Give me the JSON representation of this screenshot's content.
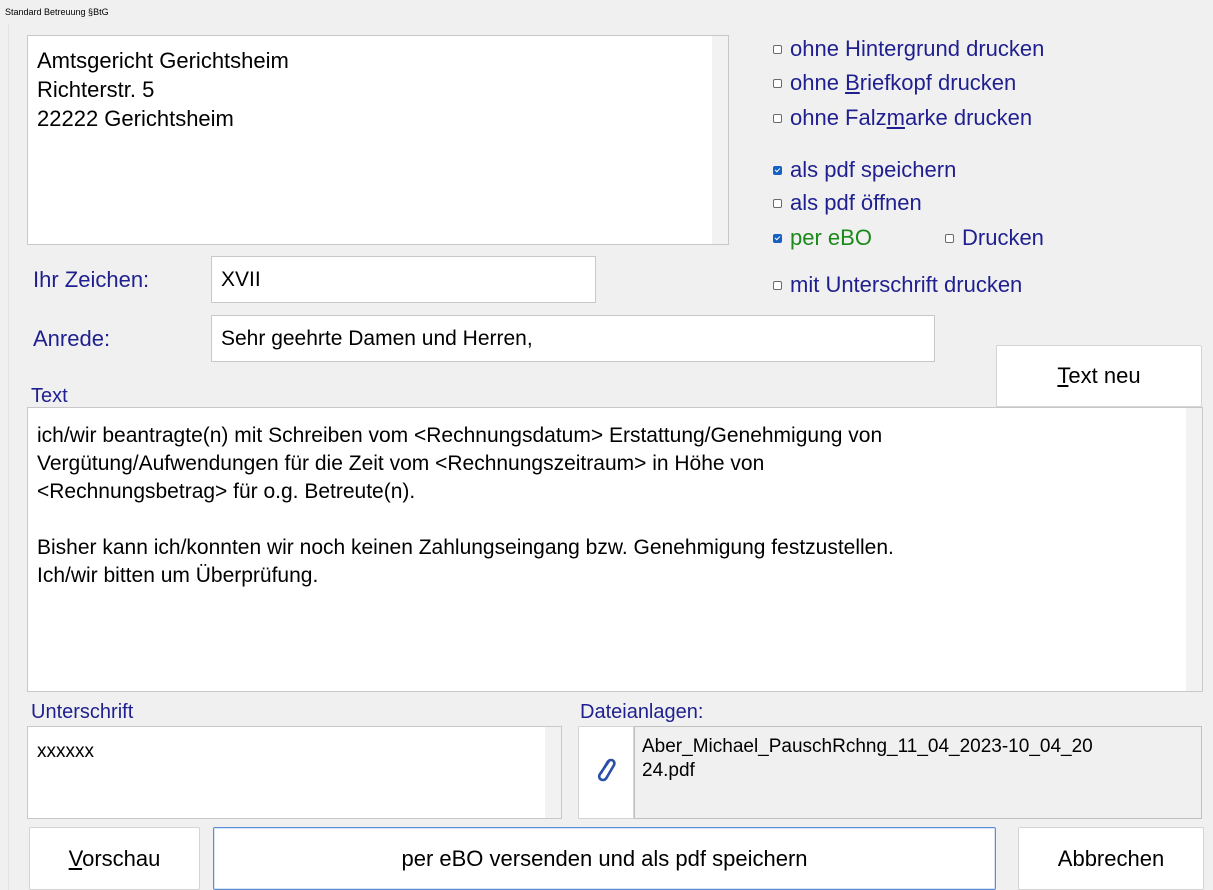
{
  "window": {
    "title": "Standard Betreuung §BtG"
  },
  "address": {
    "lines": [
      "Amtsgericht Gerichtsheim",
      "Richterstr. 5",
      "22222 Gerichtsheim"
    ]
  },
  "options": {
    "no_background": {
      "label": "ohne Hintergrund drucken",
      "checked": false
    },
    "no_letterhead": {
      "pre": "ohne ",
      "underlined": "B",
      "post": "riefkopf drucken",
      "checked": false
    },
    "no_foldmark": {
      "pre": "ohne Falz",
      "underlined": "m",
      "post": "arke drucken",
      "checked": false
    },
    "save_pdf": {
      "label": "als pdf speichern",
      "checked": true
    },
    "open_pdf": {
      "label": "als pdf öffnen",
      "checked": false
    },
    "per_ebo": {
      "label": "per eBO",
      "checked": true
    },
    "print": {
      "label": "Drucken",
      "checked": false
    },
    "with_signature": {
      "label": "mit Unterschrift drucken",
      "checked": false
    }
  },
  "fields": {
    "ihr_zeichen_label": "Ihr Zeichen:",
    "ihr_zeichen_value": "XVII",
    "anrede_label": "Anrede:",
    "anrede_value": "Sehr geehrte Damen und Herren,"
  },
  "text_section": {
    "label": "Text",
    "new_button": {
      "underlined": "T",
      "rest": "ext neu"
    },
    "lines": [
      "ich/wir beantragte(n) mit Schreiben vom <Rechnungsdatum> Erstattung/Genehmigung von",
      "Vergütung/Aufwendungen für die Zeit vom <Rechnungszeitraum> in Höhe von",
      "<Rechnungsbetrag> für o.g. Betreute(n).",
      "",
      "Bisher kann ich/konnten wir noch keinen Zahlungseingang bzw. Genehmigung festzustellen.",
      "Ich/wir bitten um Überprüfung."
    ]
  },
  "signature": {
    "label": "Unterschrift",
    "value": "xxxxxx"
  },
  "attachments": {
    "label": "Dateianlagen:",
    "icon": "paperclip-icon",
    "files": [
      "Aber_Michael_PauschRchng_11_04_2023-10_04_20",
      "24.pdf"
    ]
  },
  "buttons": {
    "preview": {
      "underlined": "V",
      "rest": "orschau"
    },
    "send": "per eBO versenden und als pdf speichern",
    "cancel": "Abbrechen"
  },
  "colors": {
    "label_blue": "#1f1f8f",
    "ebo_green": "#1b8a1b",
    "checkbox_blue": "#1560c0"
  }
}
